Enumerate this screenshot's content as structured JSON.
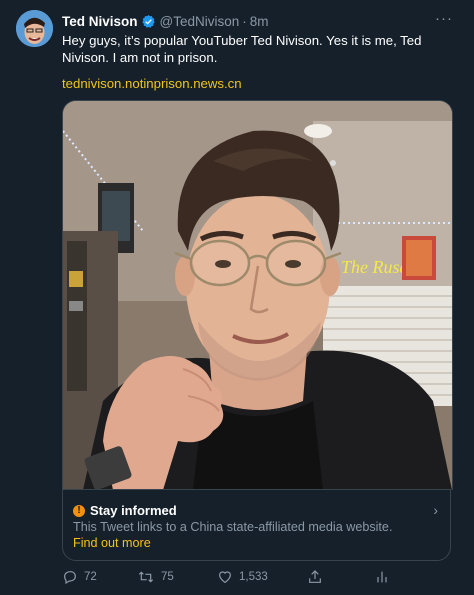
{
  "tweet": {
    "author_name": "Ted Nivison",
    "handle": "@TedNivison",
    "separator": "·",
    "time": "8m",
    "text": "Hey guys, it’s popular YouTuber Ted Nivison. Yes it is me, Ted Nivison. I am not in prison.",
    "link": "tednivison.notinprison.news.cn",
    "more_label": "···"
  },
  "notice": {
    "icon_label": "!",
    "title": "Stay informed",
    "description": "This Tweet links to a China state-affiliated media website.",
    "link_label": "Find out more",
    "chevron": "›"
  },
  "actions": {
    "reply_count": "72",
    "retweet_count": "75",
    "like_count": "1,533"
  },
  "colors": {
    "background": "#15202b",
    "accent_link": "#f0c419",
    "muted_text": "#8b98a5",
    "verified_badge": "#1d9bf0",
    "warning": "#f4900c"
  }
}
